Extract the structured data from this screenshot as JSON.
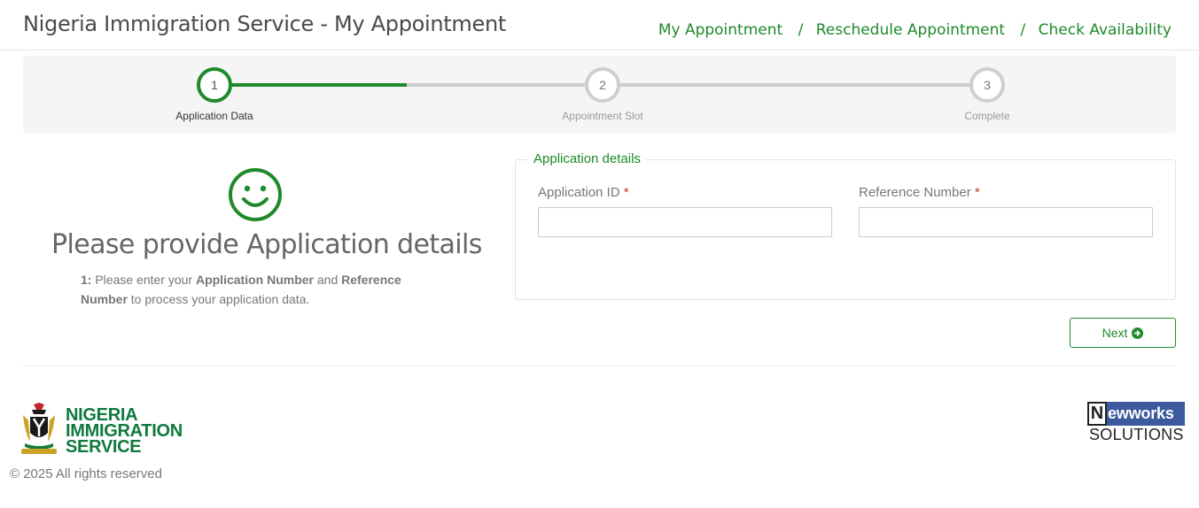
{
  "header": {
    "title": "Nigeria Immigration Service - My Appointment",
    "nav": [
      {
        "label": "My Appointment"
      },
      {
        "label": "Reschedule Appointment"
      },
      {
        "label": "Check Availability"
      }
    ],
    "separator": "/"
  },
  "stepper": {
    "steps": [
      {
        "number": "1",
        "label": "Application Data",
        "state": "active"
      },
      {
        "number": "2",
        "label": "Appointment Slot",
        "state": "pending"
      },
      {
        "number": "3",
        "label": "Complete",
        "state": "pending"
      }
    ],
    "progress_fraction": 0.33
  },
  "prompt": {
    "title": "Please provide Application details",
    "step_prefix": "1:",
    "text_1": " Please enter your ",
    "bold_1": "Application Number",
    "text_2": " and ",
    "bold_2": "Reference Number",
    "text_3": " to process your application data."
  },
  "form": {
    "legend": "Application details",
    "application_id": {
      "label": "Application ID",
      "required_mark": "*",
      "value": "",
      "placeholder": ""
    },
    "reference_number": {
      "label": "Reference Number",
      "required_mark": "*",
      "value": "",
      "placeholder": ""
    },
    "next_label": "Next"
  },
  "footer": {
    "nis_logo_text": [
      "NIGERIA",
      "IMMIGRATION",
      "SERVICE"
    ],
    "copyright": "© 2025  All rights reserved",
    "partner_logo": {
      "initial": "N",
      "rest": "ewworks",
      "sub": "SOLUTIONS"
    }
  },
  "colors": {
    "accent": "#1e8a2a",
    "nis_green": "#0f7a3d",
    "partner_blue": "#3d5a9e",
    "required": "#c0392b"
  },
  "icons": {
    "smiley": "smiley-face-icon",
    "next": "arrow-circle-right-icon",
    "coat_of_arms": "nigeria-coat-of-arms-icon"
  }
}
